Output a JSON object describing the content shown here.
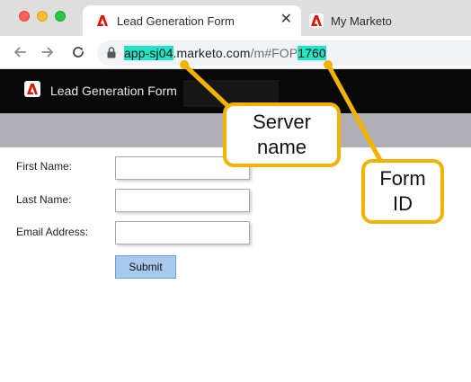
{
  "browser": {
    "tabs": [
      {
        "title": "Lead Generation Form",
        "active": true,
        "close_glyph": "✕"
      },
      {
        "title": "My Marketo",
        "active": false
      }
    ],
    "url": {
      "server": "app-sj04",
      "domain": ".marketo.com",
      "path_prefix": "/m#FOP",
      "form_id": "1760"
    }
  },
  "page": {
    "header_title": "Lead Generation Form"
  },
  "form": {
    "fields": [
      {
        "label": "First Name:",
        "value": ""
      },
      {
        "label": "Last Name:",
        "value": ""
      },
      {
        "label": "Email Address:",
        "value": ""
      }
    ],
    "submit_label": "Submit"
  },
  "annotations": {
    "server_callout": [
      "Server",
      "name"
    ],
    "form_id_callout": [
      "Form",
      "ID"
    ],
    "highlight_color": "#1ee6c8",
    "callout_color": "#f3b300"
  },
  "colors": {
    "brand_red": "#eb1000",
    "header_bg": "#080808",
    "band_grey": "#b0afb5",
    "submit_bg": "#a7c9ed"
  },
  "icons": {
    "favicon": "adobe-marketo-icon",
    "back": "arrow-left-icon",
    "forward": "arrow-right-icon",
    "reload": "reload-icon",
    "lock": "lock-icon"
  }
}
